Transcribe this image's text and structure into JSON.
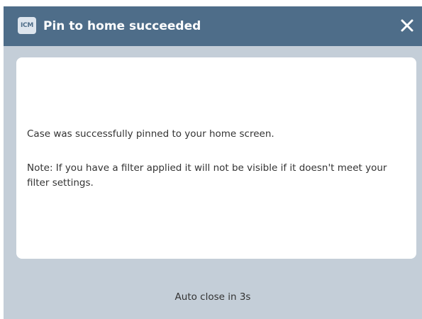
{
  "dialog": {
    "icon_text": "ICM",
    "title": "Pin to home succeeded",
    "close_icon": "close-icon",
    "message": "Case was successfully pinned to your home screen.",
    "note": "Note:  If you have a filter applied it will not be visible if it doesn't meet your filter settings.",
    "footer": "Auto close in 3s"
  },
  "colors": {
    "titlebar": "#4e6d89",
    "dialog_background": "#c4ced8",
    "content_background": "#ffffff",
    "text": "#333333"
  }
}
